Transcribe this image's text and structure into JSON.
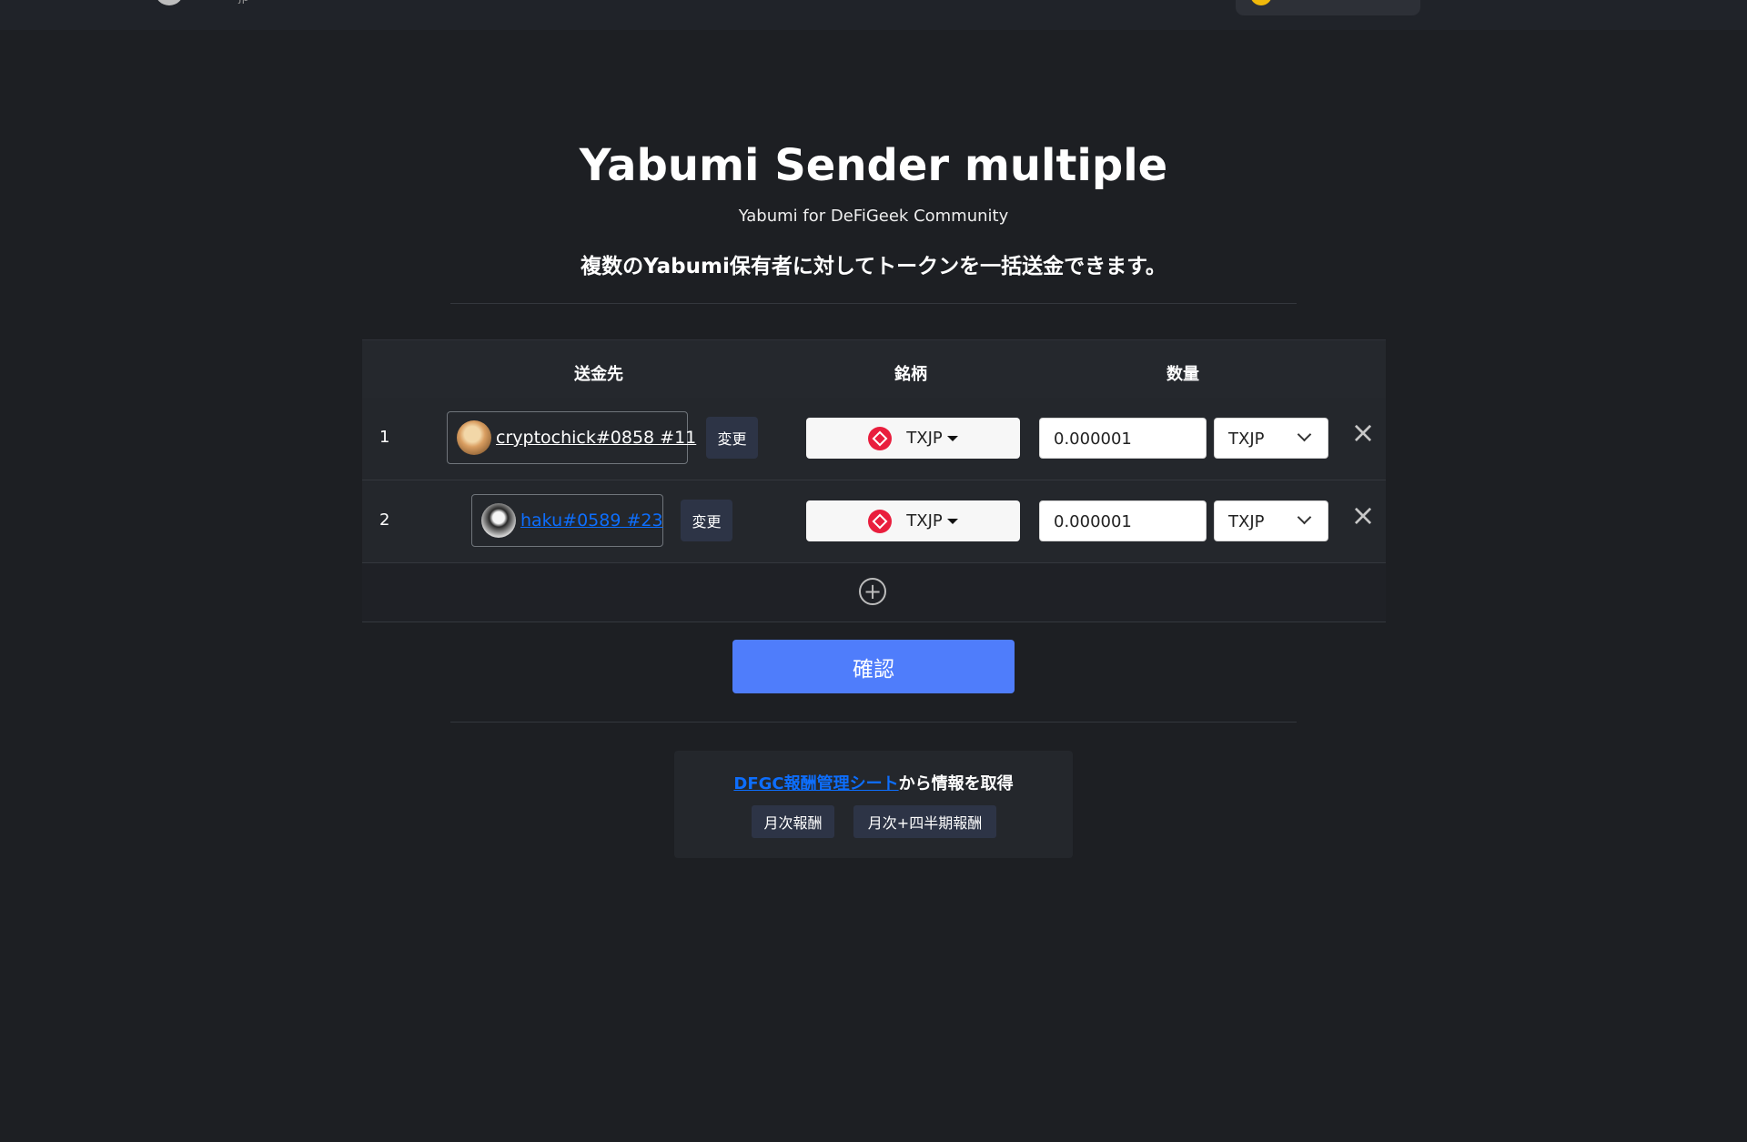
{
  "topbar": {
    "logo_text": "jp",
    "nav_items": [
      "…",
      "…",
      "…",
      "…"
    ],
    "wallet": ""
  },
  "header": {
    "title": "Yabumi Sender multiple",
    "subtitle": "Yabumi for DeFiGeek Community",
    "description": "複数のYabumi保有者に対してトークンを一括送金できます。"
  },
  "table": {
    "columns": [
      "送金先",
      "銘柄",
      "数量"
    ],
    "rows": [
      {
        "index": "1",
        "recipient": "cryptochick#0858 #11",
        "change_label": "変更",
        "token": "TXJP",
        "amount": "0.000001",
        "unit": "TXJP"
      },
      {
        "index": "2",
        "recipient": "haku#0589 #23",
        "change_label": "変更",
        "token": "TXJP",
        "amount": "0.000001",
        "unit": "TXJP"
      }
    ],
    "add_row_symbol": "+"
  },
  "actions": {
    "confirm_label": "確認"
  },
  "sheet": {
    "link_text": "DFGC報酬管理シート",
    "suffix": "から情報を取得",
    "buttons": [
      "月次報酬",
      "月次+四半期報酬"
    ]
  },
  "colors": {
    "background": "#1d1f23",
    "primary": "#4f7dfb",
    "link": "#0d6efd",
    "token_red": "#e91e3d"
  }
}
